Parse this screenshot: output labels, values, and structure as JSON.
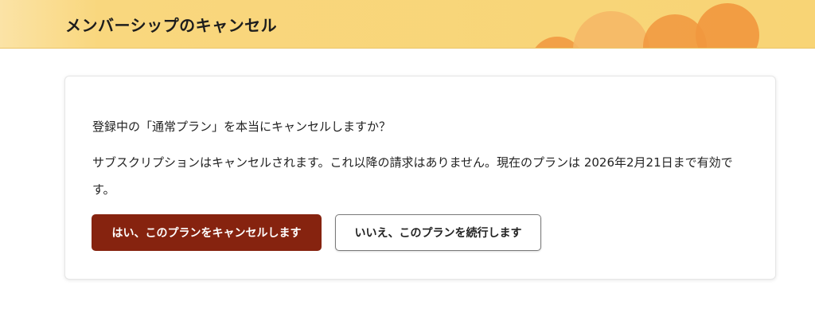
{
  "header": {
    "title": "メンバーシップのキャンセル",
    "decoration": "orange-circles"
  },
  "dialog": {
    "question": "登録中の「通常プラン」を本当にキャンセルしますか？",
    "notice": "サブスクリプションはキャンセルされます。これ以降の請求はありません。現在のプランは 2026年2月21日まで有効です。",
    "confirm_button": "はい、このプランをキャンセルします",
    "keep_button": "いいえ、このプランを続行します"
  },
  "colors": {
    "header_background": "#f8d475",
    "confirm_button": "#86230f",
    "circle_light": "#f5b866",
    "circle_dark": "#f1973e"
  }
}
